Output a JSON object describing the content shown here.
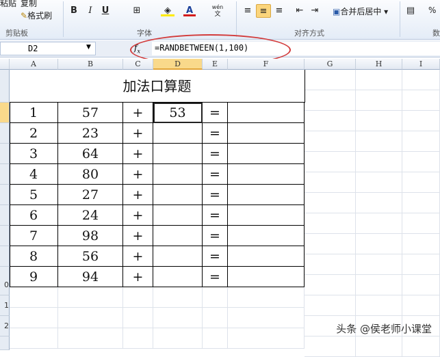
{
  "ribbon": {
    "paste": "粘贴",
    "copy": "复制",
    "format_painter": "格式刷",
    "clipboard_group": "剪贴板",
    "bold": "B",
    "italic": "I",
    "underline": "U",
    "font_group": "字体",
    "merge_center": "合并后居中",
    "align_group": "对齐方式",
    "number_group": "数",
    "percent": "%",
    "phonetic": "wén"
  },
  "formula_bar": {
    "name_box": "D2",
    "fx": "fx",
    "formula": "=RANDBETWEEN(1,100)"
  },
  "columns": [
    "A",
    "B",
    "C",
    "D",
    "E",
    "F",
    "G",
    "H",
    "I"
  ],
  "row_numbers": [
    "0",
    "1",
    "2"
  ],
  "sheet": {
    "title": "加法口算题",
    "rows": [
      {
        "n": "1",
        "a": "57",
        "op": "+",
        "b": "53",
        "eq": "="
      },
      {
        "n": "2",
        "a": "23",
        "op": "+",
        "b": "",
        "eq": "="
      },
      {
        "n": "3",
        "a": "64",
        "op": "+",
        "b": "",
        "eq": "="
      },
      {
        "n": "4",
        "a": "80",
        "op": "+",
        "b": "",
        "eq": "="
      },
      {
        "n": "5",
        "a": "27",
        "op": "+",
        "b": "",
        "eq": "="
      },
      {
        "n": "6",
        "a": "24",
        "op": "+",
        "b": "",
        "eq": "="
      },
      {
        "n": "7",
        "a": "98",
        "op": "+",
        "b": "",
        "eq": "="
      },
      {
        "n": "8",
        "a": "56",
        "op": "+",
        "b": "",
        "eq": "="
      },
      {
        "n": "9",
        "a": "94",
        "op": "+",
        "b": "",
        "eq": "="
      }
    ]
  },
  "watermark": "头条 @侯老师小课堂"
}
